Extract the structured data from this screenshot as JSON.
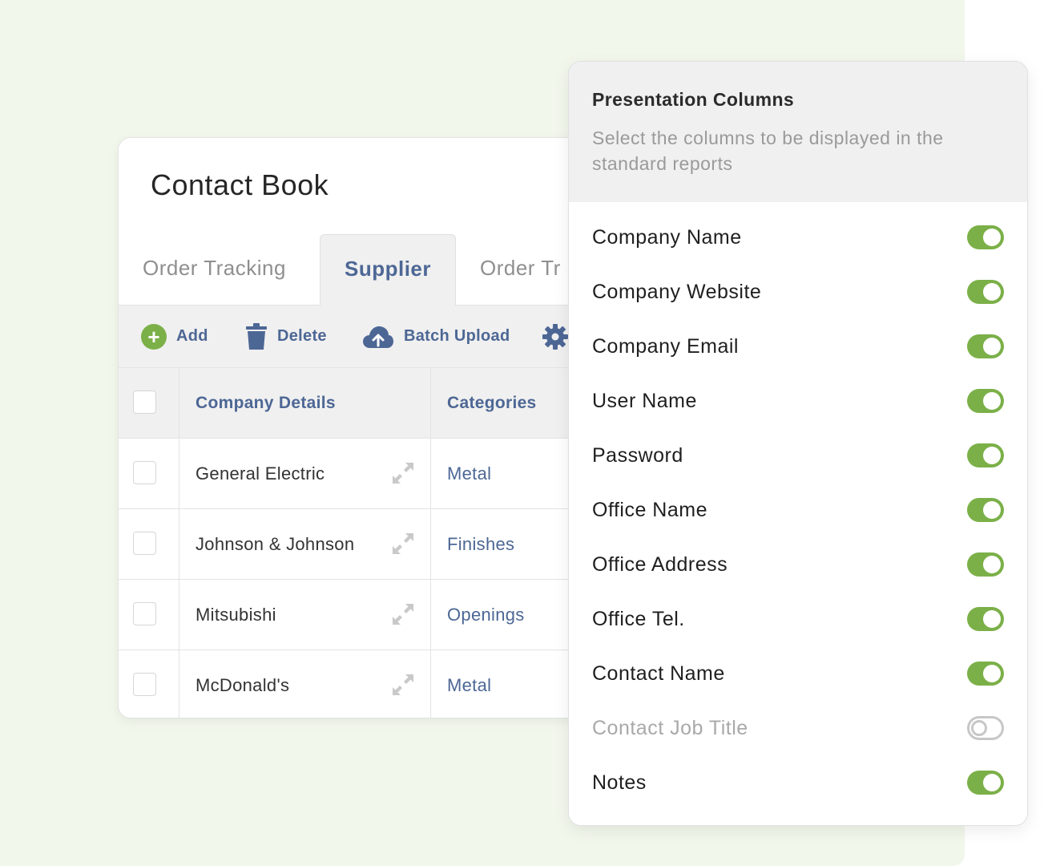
{
  "contact_book": {
    "title": "Contact Book",
    "tabs": [
      {
        "label": "Order Tracking"
      },
      {
        "label": "Supplier",
        "active": true
      },
      {
        "label": "Order Tr"
      }
    ],
    "toolbar": {
      "add_label": "Add",
      "delete_label": "Delete",
      "batch_upload_label": "Batch Upload"
    },
    "table": {
      "headers": {
        "company": "Company Details",
        "categories": "Categories"
      },
      "rows": [
        {
          "company": "General Electric",
          "category": "Metal"
        },
        {
          "company": "Johnson & Johnson",
          "category": "Finishes"
        },
        {
          "company": "Mitsubishi",
          "category": "Openings"
        },
        {
          "company": "McDonald's",
          "category": "Metal"
        }
      ]
    }
  },
  "presentation_columns": {
    "title": "Presentation Columns",
    "subtitle": "Select the columns to be displayed in the standard reports",
    "options": [
      {
        "label": "Company Name",
        "enabled": true
      },
      {
        "label": "Company Website",
        "enabled": true
      },
      {
        "label": "Company Email",
        "enabled": true
      },
      {
        "label": "User Name",
        "enabled": true
      },
      {
        "label": "Password",
        "enabled": true
      },
      {
        "label": "Office Name",
        "enabled": true
      },
      {
        "label": "Office Address",
        "enabled": true
      },
      {
        "label": "Office Tel.",
        "enabled": true
      },
      {
        "label": "Contact Name",
        "enabled": true
      },
      {
        "label": "Contact Job Title",
        "enabled": false
      },
      {
        "label": "Notes",
        "enabled": true
      }
    ]
  },
  "colors": {
    "accent_green": "#7bb048",
    "link_blue": "#4d6795",
    "background_tint": "#f2f7ec"
  },
  "icons": {
    "add": "plus-circle-icon",
    "delete": "trash-icon",
    "upload": "cloud-upload-icon",
    "settings": "gear-icon",
    "expand": "expand-arrows-icon"
  }
}
